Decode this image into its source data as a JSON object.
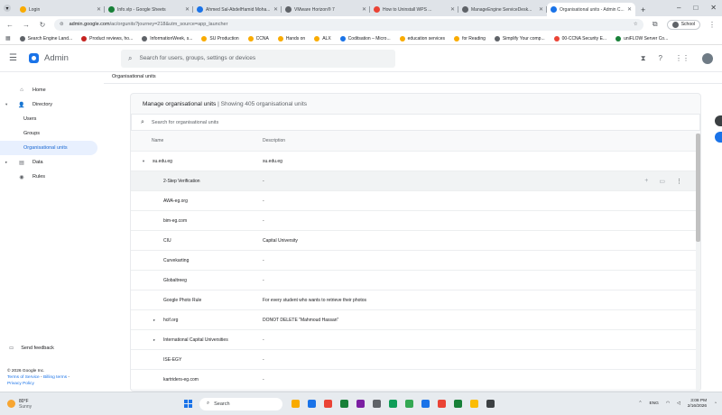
{
  "browser": {
    "tabs": [
      {
        "label": "Login",
        "color": "#f9ab00",
        "active": false
      },
      {
        "label": "Info.vlp - Google Sheets",
        "color": "#188038",
        "active": false
      },
      {
        "label": "Ahmed Sal-AbdelHamid Moha...",
        "color": "#1a73e8",
        "active": false
      },
      {
        "label": "VMware Horizon® 7",
        "color": "#5f6368",
        "active": false
      },
      {
        "label": "How to Uninstall WPS ...",
        "color": "#ea4335",
        "active": false
      },
      {
        "label": "ManageEngine ServiceDesk...",
        "color": "#5f6368",
        "active": false
      },
      {
        "label": "Organisational units - Admin C...",
        "color": "#1a73e8",
        "active": true
      }
    ],
    "url_host": "admin.google.com",
    "url_path": "/ac/orgunits?journey=218&utm_source=app_launcher",
    "profile_label": "School",
    "bookmarks": [
      {
        "label": "Search Engine Land...",
        "color": "#5f6368"
      },
      {
        "label": "Product reviews, ho...",
        "color": "#c5221f"
      },
      {
        "label": "InformationWeek, s...",
        "color": "#5f6368"
      },
      {
        "label": "SU Production",
        "color": "#f9ab00"
      },
      {
        "label": "CCNA",
        "color": "#f9ab00"
      },
      {
        "label": "Hands on",
        "color": "#f9ab00"
      },
      {
        "label": "ALX",
        "color": "#f9ab00"
      },
      {
        "label": "Coditsation – Micro...",
        "color": "#1a73e8"
      },
      {
        "label": "education services",
        "color": "#f9ab00"
      },
      {
        "label": "for Reading",
        "color": "#f9ab00"
      },
      {
        "label": "Simplify Your comp...",
        "color": "#5f6368"
      },
      {
        "label": "00-CCNA Security E...",
        "color": "#ea4335"
      },
      {
        "label": "uniFLOW Server Co...",
        "color": "#188038"
      }
    ]
  },
  "app": {
    "name": "Admin",
    "search_placeholder": "Search for users, groups, settings or devices",
    "breadcrumb": "Organisational units"
  },
  "sidebar": {
    "items": [
      {
        "label": "Home",
        "icon": "home-icon",
        "glyph": "⌂",
        "level": 0,
        "active": false,
        "caret": ""
      },
      {
        "label": "Directory",
        "icon": "person-icon",
        "glyph": "👤",
        "level": 0,
        "active": false,
        "caret": "▾"
      },
      {
        "label": "Users",
        "icon": "",
        "glyph": "",
        "level": 1,
        "active": false,
        "caret": ""
      },
      {
        "label": "Groups",
        "icon": "",
        "glyph": "",
        "level": 1,
        "active": false,
        "caret": ""
      },
      {
        "label": "Organisational units",
        "icon": "",
        "glyph": "",
        "level": 1,
        "active": true,
        "caret": ""
      },
      {
        "label": "Data",
        "icon": "data-icon",
        "glyph": "▤",
        "level": 0,
        "active": false,
        "caret": "▸"
      },
      {
        "label": "Rules",
        "icon": "rules-icon",
        "glyph": "◉",
        "level": 0,
        "active": false,
        "caret": ""
      }
    ],
    "feedback": "Send feedback",
    "copyright": "© 2026 Google Inc.",
    "terms": "Terms of Service",
    "billing": "Billing terms",
    "privacy": "Privacy Policy"
  },
  "panel": {
    "title": "Manage organisational units",
    "count_text": "| Showing 405 organisational units",
    "filter_placeholder": "Search for organisational units",
    "col_name": "Name",
    "col_desc": "Description",
    "rows": [
      {
        "name": "su.edu.eg",
        "desc": "su.edu.eg",
        "indent": 0,
        "expander": "▾",
        "highlight": false
      },
      {
        "name": "2-Step Verification",
        "desc": "-",
        "indent": 1,
        "expander": "",
        "highlight": true
      },
      {
        "name": "AWA-eg.org",
        "desc": "-",
        "indent": 1,
        "expander": "",
        "highlight": false
      },
      {
        "name": "bim-eg.com",
        "desc": "-",
        "indent": 1,
        "expander": "",
        "highlight": false
      },
      {
        "name": "CIU",
        "desc": "Capital University",
        "indent": 1,
        "expander": "",
        "highlight": false
      },
      {
        "name": "Curvekarting",
        "desc": "-",
        "indent": 1,
        "expander": "",
        "highlight": false
      },
      {
        "name": "Globaltreeg",
        "desc": "-",
        "indent": 1,
        "expander": "",
        "highlight": false
      },
      {
        "name": "Google Photo Rule",
        "desc": "For every student who wants to retrieve their photos",
        "indent": 1,
        "expander": "",
        "highlight": false
      },
      {
        "name": "hcif.org",
        "desc": "DONOT DELETE \"Mahmoud Hassan\"",
        "indent": 1,
        "expander": "▸",
        "highlight": false
      },
      {
        "name": "International Capital Universities",
        "desc": "-",
        "indent": 1,
        "expander": "▸",
        "highlight": false
      },
      {
        "name": "ISE-EGY",
        "desc": "-",
        "indent": 1,
        "expander": "",
        "highlight": false
      },
      {
        "name": "kartriders-eg.com",
        "desc": "-",
        "indent": 1,
        "expander": "",
        "highlight": false
      }
    ]
  },
  "taskbar": {
    "temp": "80°F",
    "weather": "Sunny",
    "search": "Search",
    "lang": "ENG",
    "time": "3:08 PM",
    "date": "2/16/2026",
    "apps": [
      "#f9ab00",
      "#1a73e8",
      "#ea4335",
      "#188038",
      "#7b1fa2",
      "#5f6368",
      "#0f9d58",
      "#34a853",
      "#1a73e8",
      "#ea4335",
      "#188038",
      "#fbbc04",
      "#3c4043"
    ]
  }
}
